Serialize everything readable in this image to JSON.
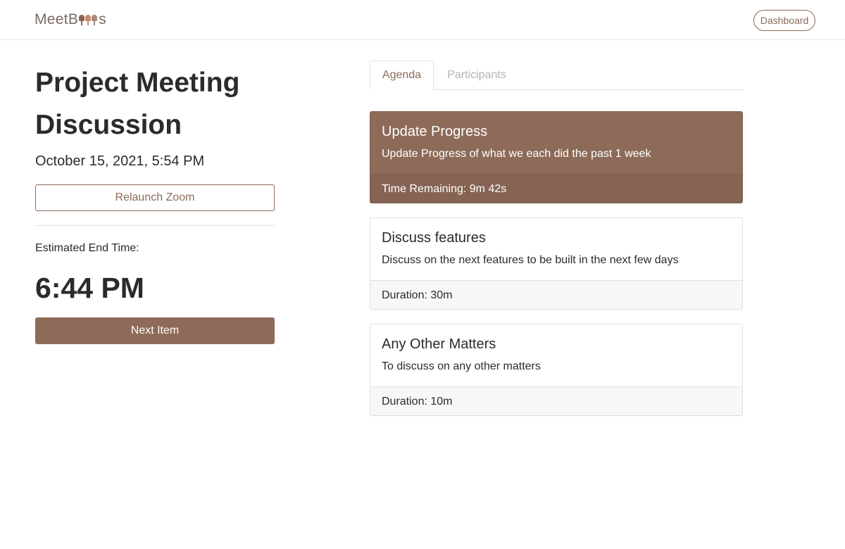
{
  "header": {
    "logo_prefix": "MeetB",
    "logo_suffix": "s",
    "dashboard_label": "Dashboard"
  },
  "meeting": {
    "title": "Project Meeting Discussion",
    "datetime": "October 15, 2021, 5:54 PM",
    "relaunch_label": "Relaunch Zoom",
    "est_end_label": "Estimated End Time:",
    "est_end_time": "6:44 PM",
    "next_label": "Next Item"
  },
  "tabs": [
    {
      "label": "Agenda",
      "active": true
    },
    {
      "label": "Participants",
      "active": false
    }
  ],
  "agenda": [
    {
      "title": "Update Progress",
      "description": "Update Progress of what we each did the past 1 week",
      "footer": "Time Remaining: 9m 42s",
      "current": true
    },
    {
      "title": "Discuss features",
      "description": "Discuss on the next features to be built in the next few days",
      "footer": "Duration: 30m",
      "current": false
    },
    {
      "title": "Any Other Matters",
      "description": "To discuss on any other matters",
      "footer": "Duration: 10m",
      "current": false
    }
  ],
  "colors": {
    "brand": "#8d6b58",
    "muted_tab": "#b3b3b3",
    "card_footer": "#f7f7f7"
  },
  "icons": {
    "logo_bells": "bell-icons"
  }
}
